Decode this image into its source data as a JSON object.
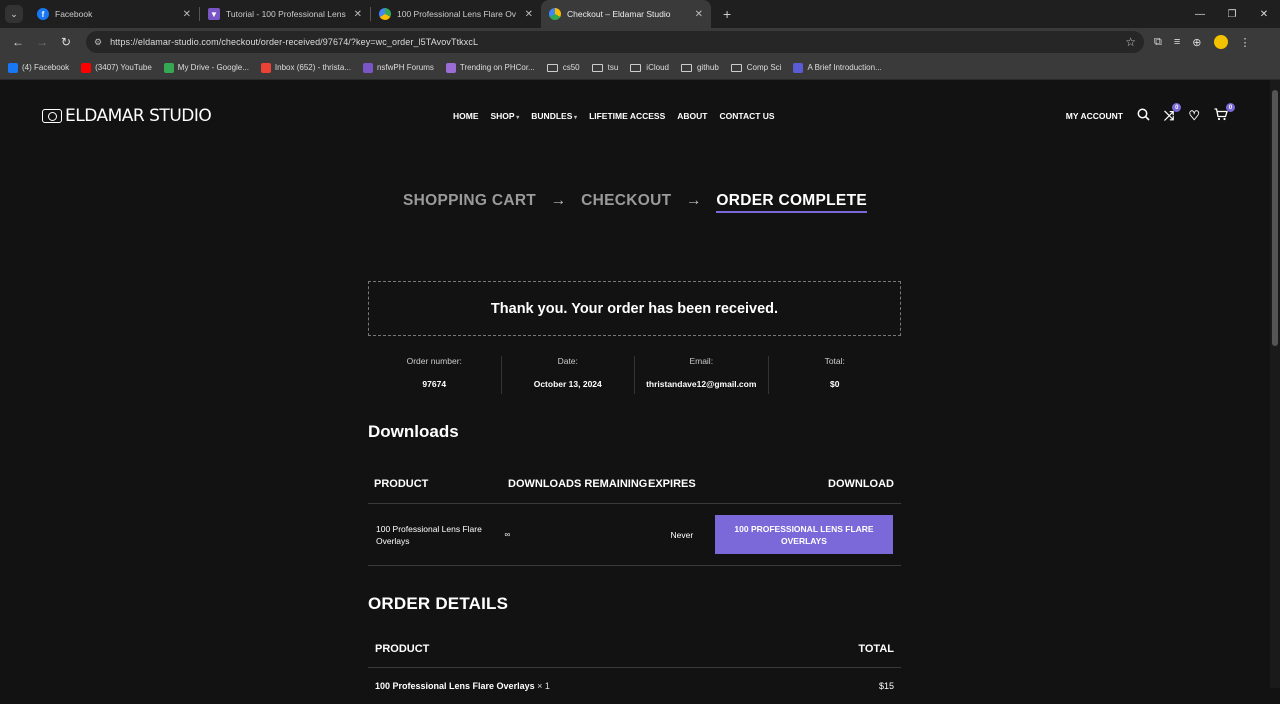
{
  "browser": {
    "tabs": [
      {
        "title": "Facebook",
        "icon": "facebook-icon",
        "color": "#1877f2"
      },
      {
        "title": "Tutorial - 100 Professional Lens",
        "icon": "nsfw-icon",
        "color": "#7a55c7"
      },
      {
        "title": "100 Professional Lens Flare Ov",
        "icon": "drive-icon",
        "color": "#34a853"
      },
      {
        "title": "Checkout – Eldamar Studio",
        "icon": "drive-icon",
        "color": "#fbbc04"
      }
    ],
    "url": "https://eldamar-studio.com/checkout/order-received/97674/?key=wc_order_l5TAvovTtkxcL",
    "bookmarks": [
      {
        "label": "(4) Facebook",
        "type": "site",
        "color": "#1877f2"
      },
      {
        "label": "(3407) YouTube",
        "type": "site",
        "color": "#ff0000"
      },
      {
        "label": "My Drive - Google...",
        "type": "site",
        "color": "#34a853"
      },
      {
        "label": "Inbox (652) - thrista...",
        "type": "site",
        "color": "#ea4335"
      },
      {
        "label": "nsfwPH Forums",
        "type": "site",
        "color": "#7a55c7"
      },
      {
        "label": "Trending on PHCor...",
        "type": "site",
        "color": "#9b6bd6"
      },
      {
        "label": "cs50",
        "type": "folder"
      },
      {
        "label": "tsu",
        "type": "folder"
      },
      {
        "label": "iCloud",
        "type": "folder"
      },
      {
        "label": "github",
        "type": "folder"
      },
      {
        "label": "Comp Sci",
        "type": "folder"
      },
      {
        "label": "A Brief Introduction...",
        "type": "site",
        "color": "#5b5bd6"
      }
    ]
  },
  "site": {
    "logo": "ELDAMAR STUDIO",
    "nav": [
      "HOME",
      "SHOP",
      "BUNDLES",
      "LIFETIME ACCESS",
      "ABOUT",
      "CONTACT US"
    ],
    "account": "MY ACCOUNT",
    "compare_count": "0",
    "cart_count": "0",
    "accent": "#7b68d9"
  },
  "steps": {
    "cart": "SHOPPING CART",
    "checkout": "CHECKOUT",
    "complete": "ORDER COMPLETE"
  },
  "order": {
    "thank_you": "Thank you. Your order has been received.",
    "number_label": "Order number:",
    "number": "97674",
    "date_label": "Date:",
    "date": "October 13, 2024",
    "email_label": "Email:",
    "email": "thristandave12@gmail.com",
    "total_label": "Total:",
    "total": "$0"
  },
  "downloads": {
    "title": "Downloads",
    "headers": [
      "PRODUCT",
      "DOWNLOADS REMAINING",
      "EXPIRES",
      "DOWNLOAD"
    ],
    "row": {
      "product": "100 Professional Lens Flare Overlays",
      "remaining": "∞",
      "expires": "Never",
      "button": "100 PROFESSIONAL LENS FLARE OVERLAYS"
    }
  },
  "order_details": {
    "title": "ORDER DETAILS",
    "headers": [
      "PRODUCT",
      "TOTAL"
    ],
    "row": {
      "product": "100 Professional Lens Flare Overlays",
      "qty": "× 1",
      "total": "$15"
    }
  }
}
